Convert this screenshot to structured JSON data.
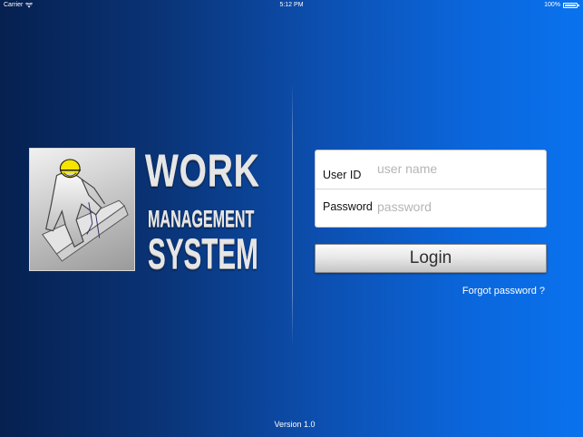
{
  "status_bar": {
    "carrier": "Carrier",
    "time": "5:12 PM",
    "battery": "100%",
    "battery_level": 1.0,
    "wifi_icon": "wifi-icon",
    "battery_icon": "battery-icon"
  },
  "logo": {
    "word1": "WORK",
    "word2": "MANAGEMENT",
    "word3": "SYSTEM",
    "image_icon": "construction-worker-icon",
    "helmet_color": "#f5e400"
  },
  "login": {
    "user_label": "User ID",
    "user_placeholder": "user name",
    "password_label": "Password",
    "password_placeholder": "password",
    "button_label": "Login",
    "forgot_label": "Forgot password ?"
  },
  "footer": {
    "version": "Version 1.0"
  },
  "colors": {
    "background_left": "#062050",
    "background_right": "#0a72ee",
    "text": "#ffffff"
  }
}
